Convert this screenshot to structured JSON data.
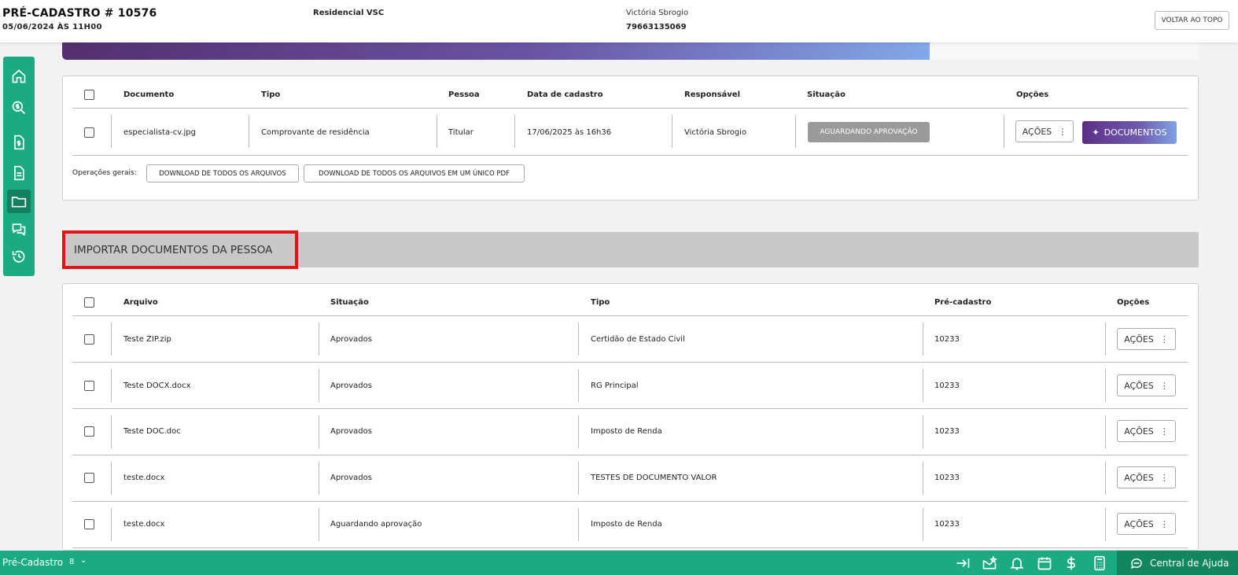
{
  "header": {
    "title": "PRÉ-CADASTRO # 10576",
    "datetime": "05/06/2024 ÀS 11H00",
    "empreendimento": "Residencial VSC",
    "person_name": "Victória Sbrogio",
    "person_phone": "79663135069",
    "back_to_top": "VOLTAR AO TOPO"
  },
  "sidebar": {
    "items": [
      {
        "icon": "home-icon"
      },
      {
        "icon": "money-search-icon"
      },
      {
        "icon": "money-document-icon"
      },
      {
        "icon": "document-icon"
      },
      {
        "icon": "folder-icon",
        "active": true
      },
      {
        "icon": "chat-icon"
      },
      {
        "icon": "history-icon"
      }
    ]
  },
  "documents_table": {
    "headers": {
      "documento": "Documento",
      "tipo": "Tipo",
      "pessoa": "Pessoa",
      "data": "Data de cadastro",
      "responsavel": "Responsável",
      "situacao": "Situação",
      "opcoes": "Opções"
    },
    "row": {
      "documento": "especialista-cv.jpg",
      "tipo": "Comprovante de residência",
      "pessoa": "Titular",
      "data": "17/06/2025 às 16h36",
      "responsavel": "Victória Sbrogio",
      "situacao": "AGUARDANDO APROVAÇÃO",
      "acoes": "AÇÕES",
      "documentos": "DOCUMENTOS"
    },
    "operations_label": "Operações gerais:",
    "download_all": "DOWNLOAD DE TODOS OS ARQUIVOS",
    "download_pdf": "DOWNLOAD DE TODOS OS ARQUIVOS EM UM ÚNICO PDF"
  },
  "import_section": {
    "title": "IMPORTAR DOCUMENTOS DA PESSOA"
  },
  "import_table": {
    "headers": {
      "arquivo": "Arquivo",
      "situacao": "Situação",
      "tipo": "Tipo",
      "pre_cadastro": "Pré-cadastro",
      "opcoes": "Opções"
    },
    "acoes_label": "AÇÕES",
    "rows": [
      {
        "arquivo": "Teste ZIP.zip",
        "situacao": "Aprovados",
        "tipo": "Certidão de Estado Civil",
        "pre_cadastro": "10233"
      },
      {
        "arquivo": "Teste DOCX.docx",
        "situacao": "Aprovados",
        "tipo": "RG Principal",
        "pre_cadastro": "10233"
      },
      {
        "arquivo": "Teste DOC.doc",
        "situacao": "Aprovados",
        "tipo": "Imposto de Renda",
        "pre_cadastro": "10233"
      },
      {
        "arquivo": "teste.docx",
        "situacao": "Aprovados",
        "tipo": "TESTES DE DOCUMENTO VALOR",
        "pre_cadastro": "10233"
      },
      {
        "arquivo": "teste.docx",
        "situacao": "Aguardando aprovação",
        "tipo": "Imposto de Renda",
        "pre_cadastro": "10233"
      }
    ]
  },
  "footer": {
    "module": "Pré-Cadastro",
    "count": "8",
    "help": "Central de Ajuda"
  },
  "colors": {
    "brand_green": "#1aab82",
    "brand_green_dark": "#11865f",
    "purple": "#5b2f86",
    "highlight_red": "#e01414"
  }
}
